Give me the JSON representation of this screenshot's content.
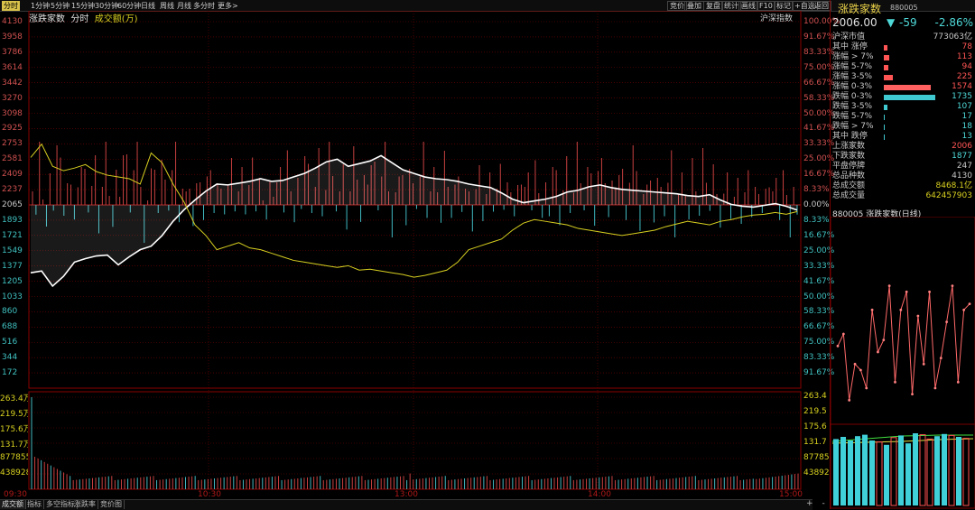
{
  "toolbar": {
    "periods": [
      "分时",
      "1分钟",
      "5分钟",
      "15分钟",
      "30分钟",
      "60分钟",
      "日线",
      "周线",
      "月线",
      "多分时",
      "更多>"
    ],
    "active": 0,
    "right_buttons": [
      "竞价",
      "叠加",
      "复盘",
      "统计",
      "画线",
      "F10",
      "标记",
      "+自选",
      "返回"
    ]
  },
  "legend": {
    "name": "涨跌家数",
    "tab": "分时",
    "sub": "成交额(万)"
  },
  "market_label": "沪深指数",
  "axes": {
    "price_ticks": [
      "4130",
      "3958",
      "3786",
      "3614",
      "3442",
      "3270",
      "3098",
      "2925",
      "2753",
      "2581",
      "2409",
      "2237",
      "2065",
      "1893",
      "1721",
      "1549",
      "1377",
      "1205",
      "1033",
      "860",
      "688",
      "516",
      "344",
      "172"
    ],
    "pct_ticks": [
      "100.00%",
      "91.67%",
      "83.33%",
      "75.00%",
      "66.67%",
      "58.33%",
      "50.00%",
      "41.67%",
      "33.33%",
      "25.00%",
      "16.67%",
      "8.33%",
      "0.00%",
      "8.33%",
      "16.67%",
      "25.00%",
      "33.33%",
      "41.67%",
      "50.00%",
      "58.33%",
      "66.67%",
      "75.00%",
      "83.33%",
      "91.67%"
    ],
    "vol_ticks_left": [
      "263.4万",
      "219.5万",
      "175.6万",
      "131.7万",
      "877855",
      "438928"
    ],
    "vol_ticks_right": [
      "263.4",
      "219.5",
      "175.6",
      "131.7",
      "877855",
      "438928"
    ],
    "time_ticks": [
      "09:30",
      "10:30",
      "13:00",
      "14:00",
      "15:00"
    ]
  },
  "chart_data": {
    "type": "line",
    "x": [
      "09:30",
      "15:00"
    ],
    "base": 2065,
    "ylim": [
      0,
      4130
    ],
    "series": [
      {
        "values": [
          1300,
          1320,
          1150,
          1260,
          1420,
          1460,
          1490,
          1500,
          1390,
          1480,
          1560,
          1600,
          1720,
          1880,
          2010,
          2120,
          2220,
          2300,
          2290,
          2310,
          2330,
          2360,
          2330,
          2340,
          2380,
          2420,
          2480,
          2550,
          2580,
          2500,
          2530,
          2560,
          2620,
          2540,
          2460,
          2420,
          2380,
          2360,
          2350,
          2330,
          2300,
          2280,
          2260,
          2200,
          2130,
          2090,
          2110,
          2130,
          2160,
          2210,
          2230,
          2270,
          2290,
          2260,
          2240,
          2230,
          2220,
          2210,
          2200,
          2190,
          2170,
          2160,
          2180,
          2120,
          2070,
          2050,
          2040,
          2060,
          2080,
          2050,
          2006
        ],
        "color": "#ffffff"
      },
      {
        "values": [
          2600,
          2750,
          2500,
          2450,
          2480,
          2520,
          2440,
          2400,
          2380,
          2360,
          2300,
          2650,
          2540,
          2300,
          2100,
          1840,
          1720,
          1560,
          1600,
          1640,
          1580,
          1560,
          1520,
          1480,
          1440,
          1420,
          1400,
          1380,
          1360,
          1380,
          1330,
          1340,
          1320,
          1300,
          1280,
          1250,
          1270,
          1300,
          1330,
          1420,
          1560,
          1600,
          1640,
          1680,
          1780,
          1860,
          1900,
          1880,
          1860,
          1840,
          1800,
          1780,
          1760,
          1740,
          1720,
          1740,
          1760,
          1780,
          1820,
          1850,
          1880,
          1860,
          1840,
          1880,
          1900,
          1930,
          1950,
          1960,
          1980,
          1960,
          1990
        ],
        "color": "#d8d020"
      }
    ],
    "volume": [
      263.4,
      220,
      180,
      170,
      160,
      150,
      140,
      135,
      130,
      128,
      126,
      124,
      122,
      120,
      118,
      116,
      114,
      112,
      110,
      108,
      106,
      104,
      102,
      100,
      98,
      96,
      94,
      92,
      90,
      88,
      86,
      84,
      82,
      80,
      78,
      76,
      74,
      72,
      70,
      68,
      66,
      64,
      62,
      60,
      58,
      56,
      54,
      52,
      50,
      48,
      46,
      44,
      42,
      40,
      38,
      36,
      34,
      32,
      30,
      28,
      26,
      24,
      22,
      20,
      18,
      16,
      14,
      12,
      10,
      8,
      6
    ],
    "volume_unit": "万",
    "vol_ylim": [
      0,
      263.4
    ]
  },
  "side": {
    "title": "涨跌家数",
    "code": "880005",
    "price": "2006.00",
    "change": "-59",
    "pct": "-2.86%",
    "rows": [
      {
        "k": "沪深市值",
        "v": "773063亿",
        "c": "#c8c8c8"
      },
      {
        "k": "其中  涨停",
        "v": "78",
        "c": "#ff5555",
        "bar": 4,
        "bc": "#ff5555"
      },
      {
        "k": "涨幅 > 7%",
        "v": "113",
        "c": "#ff5555",
        "bar": 6,
        "bc": "#ff5555"
      },
      {
        "k": "涨幅 5-7%",
        "v": "94",
        "c": "#ff5555",
        "bar": 5,
        "bc": "#ff5555"
      },
      {
        "k": "涨幅 3-5%",
        "v": "225",
        "c": "#ff5555",
        "bar": 10,
        "bc": "#ff5555"
      },
      {
        "k": "涨幅 0-3%",
        "v": "1574",
        "c": "#ff5555",
        "bar": 52,
        "bc": "#ff6060"
      },
      {
        "k": "跌幅 0-3%",
        "v": "1735",
        "c": "#4fd8d8",
        "bar": 57,
        "bc": "#40c8d0"
      },
      {
        "k": "跌幅 3-5%",
        "v": "107",
        "c": "#4fd8d8",
        "bar": 4,
        "bc": "#40c8d0"
      },
      {
        "k": "跌幅 5-7%",
        "v": "17",
        "c": "#4fd8d8",
        "bar": 1,
        "bc": "#40c8d0"
      },
      {
        "k": "跌幅 > 7%",
        "v": "18",
        "c": "#4fd8d8",
        "bar": 1,
        "bc": "#40c8d0"
      },
      {
        "k": "其中  跌停",
        "v": "13",
        "c": "#4fd8d8",
        "bar": 1,
        "bc": "#40c8d0"
      },
      {
        "k": "上涨家数",
        "v": "2006",
        "c": "#ff5555"
      },
      {
        "k": "下跌家数",
        "v": "1877",
        "c": "#4fd8d8"
      },
      {
        "k": "平盘停牌",
        "v": "247",
        "c": "#c8c8c8"
      },
      {
        "k": "总品种数",
        "v": "4130",
        "c": "#c8c8c8"
      },
      {
        "k": "总成交额",
        "v": "8468.1亿",
        "c": "#d8d020"
      },
      {
        "k": "总成交量",
        "v": "642457903",
        "c": "#d8d020"
      }
    ],
    "daily_label": "880005 涨跌家数(日线)",
    "daily_line": [
      1500,
      1700,
      600,
      1200,
      1100,
      800,
      2100,
      1400,
      1600,
      2500,
      900,
      2100,
      2400,
      700,
      2000,
      1200,
      2400,
      800,
      1300,
      1900,
      2500,
      900,
      2100,
      2200
    ],
    "daily_vol": [
      {
        "v": 0.92,
        "c": "#40d0d8",
        "o": false
      },
      {
        "v": 0.95,
        "c": "#40d0d8",
        "o": false
      },
      {
        "v": 0.9,
        "c": "#40d0d8",
        "o": false
      },
      {
        "v": 0.96,
        "c": "#40d0d8",
        "o": false
      },
      {
        "v": 0.98,
        "c": "#40d0d8",
        "o": false
      },
      {
        "v": 0.9,
        "c": "#40d0d8",
        "o": false
      },
      {
        "v": 0.88,
        "c": "#ff5050",
        "o": true
      },
      {
        "v": 0.84,
        "c": "#40d0d8",
        "o": false
      },
      {
        "v": 0.94,
        "c": "#ff5050",
        "o": true
      },
      {
        "v": 0.97,
        "c": "#40d0d8",
        "o": false
      },
      {
        "v": 0.86,
        "c": "#40d0d8",
        "o": false
      },
      {
        "v": 1.0,
        "c": "#40d0d8",
        "o": false
      },
      {
        "v": 0.98,
        "c": "#ff5050",
        "o": true
      },
      {
        "v": 0.92,
        "c": "#ff5050",
        "o": true
      },
      {
        "v": 0.96,
        "c": "#40d0d8",
        "o": false
      },
      {
        "v": 0.99,
        "c": "#40d0d8",
        "o": false
      },
      {
        "v": 0.97,
        "c": "#ff5050",
        "o": true
      },
      {
        "v": 0.95,
        "c": "#40d0d8",
        "o": false
      },
      {
        "v": 0.93,
        "c": "#ff5050",
        "o": true
      }
    ]
  },
  "bottom_tabs": [
    "成交额",
    "指标",
    "多空指标",
    "涨跌率",
    "竞价图"
  ],
  "bottom_nav": [
    "+",
    "-"
  ]
}
